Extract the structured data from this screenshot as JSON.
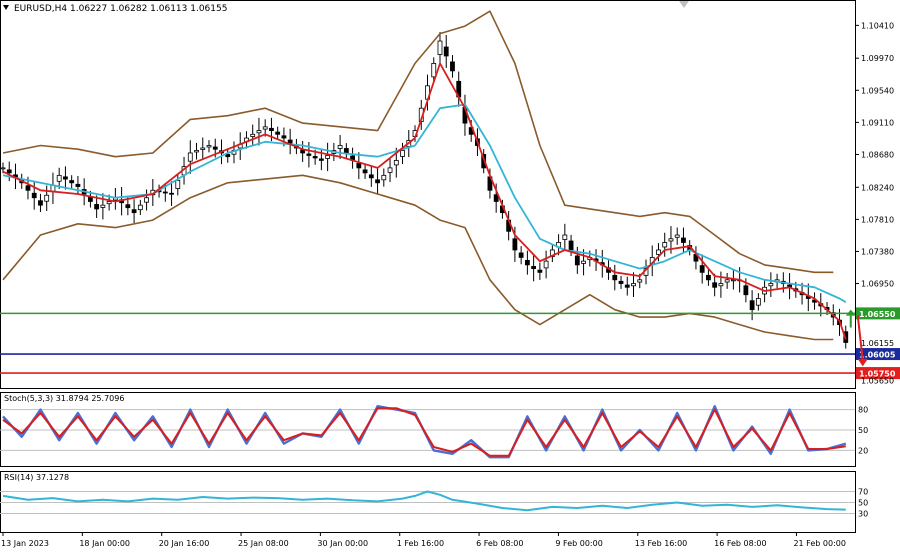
{
  "chart_data": [
    {
      "type": "candlestick",
      "title": "EURUSD,H4",
      "ohlc_text": "1.06227 1.06282 1.06113 1.06155",
      "ylim": [
        1.0555,
        1.1075
      ],
      "y_ticks": [
        "1.10410",
        "1.09970",
        "1.09540",
        "1.09110",
        "1.08680",
        "1.08240",
        "1.07810",
        "1.07380",
        "1.06950"
      ],
      "x_ticks": [
        "13 Jan 2023",
        "18 Jan 00:00",
        "20 Jan 16:00",
        "25 Jan 08:00",
        "30 Jan 00:00",
        "1 Feb 16:00",
        "6 Feb 08:00",
        "9 Feb 00:00",
        "13 Feb 16:00",
        "16 Feb 08:00",
        "21 Feb 00:00"
      ],
      "levels": [
        {
          "label": "1.06550",
          "value": 1.0655,
          "color": "#2a9a2a"
        },
        {
          "label": "1.06005",
          "value": 1.06005,
          "color": "#1a2a9a"
        },
        {
          "label": "1.05750",
          "value": 1.0575,
          "color": "#e21e1e"
        }
      ],
      "current_price_label": "1.06155",
      "bottom_price_label": "1.05650",
      "close_path": [
        [
          0,
          1.085
        ],
        [
          3,
          1.083
        ],
        [
          6,
          1.08
        ],
        [
          9,
          1.084
        ],
        [
          12,
          1.0825
        ],
        [
          15,
          1.0795
        ],
        [
          18,
          1.081
        ],
        [
          21,
          1.079
        ],
        [
          24,
          1.082
        ],
        [
          27,
          1.0815
        ],
        [
          30,
          1.087
        ],
        [
          33,
          1.088
        ],
        [
          36,
          1.0865
        ],
        [
          39,
          1.089
        ],
        [
          42,
          1.0905
        ],
        [
          45,
          1.089
        ],
        [
          48,
          1.087
        ],
        [
          51,
          1.086
        ],
        [
          54,
          1.088
        ],
        [
          57,
          1.085
        ],
        [
          60,
          1.083
        ],
        [
          63,
          1.086
        ],
        [
          66,
          1.09
        ],
        [
          68,
          1.096
        ],
        [
          70,
          1.102
        ],
        [
          72,
          1.098
        ],
        [
          74,
          1.091
        ],
        [
          76,
          1.088
        ],
        [
          78,
          1.082
        ],
        [
          80,
          1.079
        ],
        [
          82,
          1.074
        ],
        [
          84,
          1.072
        ],
        [
          86,
          1.071
        ],
        [
          88,
          1.074
        ],
        [
          90,
          1.076
        ],
        [
          92,
          1.072
        ],
        [
          94,
          1.073
        ],
        [
          96,
          1.072
        ],
        [
          98,
          1.07
        ],
        [
          100,
          1.069
        ],
        [
          102,
          1.07
        ],
        [
          104,
          1.073
        ],
        [
          106,
          1.075
        ],
        [
          108,
          1.076
        ],
        [
          110,
          1.074
        ],
        [
          112,
          1.071
        ],
        [
          114,
          1.069
        ],
        [
          116,
          1.07
        ],
        [
          118,
          1.07
        ],
        [
          120,
          1.066
        ],
        [
          122,
          1.069
        ],
        [
          124,
          1.07
        ],
        [
          126,
          1.069
        ],
        [
          128,
          1.068
        ],
        [
          130,
          1.067
        ],
        [
          132,
          1.066
        ],
        [
          134,
          1.064
        ],
        [
          135,
          1.0616
        ]
      ],
      "sma_fast": [
        [
          0,
          1.0845
        ],
        [
          6,
          1.082
        ],
        [
          12,
          1.0815
        ],
        [
          18,
          1.0805
        ],
        [
          24,
          1.0815
        ],
        [
          30,
          1.0855
        ],
        [
          36,
          1.0875
        ],
        [
          42,
          1.0895
        ],
        [
          48,
          1.0875
        ],
        [
          54,
          1.0865
        ],
        [
          60,
          1.085
        ],
        [
          66,
          1.089
        ],
        [
          70,
          1.099
        ],
        [
          74,
          1.093
        ],
        [
          78,
          1.084
        ],
        [
          82,
          1.076
        ],
        [
          86,
          1.0725
        ],
        [
          90,
          1.074
        ],
        [
          94,
          1.073
        ],
        [
          98,
          1.071
        ],
        [
          102,
          1.0705
        ],
        [
          106,
          1.074
        ],
        [
          110,
          1.0745
        ],
        [
          114,
          1.0705
        ],
        [
          118,
          1.07
        ],
        [
          122,
          1.0685
        ],
        [
          126,
          1.069
        ],
        [
          130,
          1.0675
        ],
        [
          134,
          1.0645
        ],
        [
          135,
          1.062
        ]
      ],
      "sma_slow": [
        [
          0,
          1.084
        ],
        [
          6,
          1.083
        ],
        [
          12,
          1.082
        ],
        [
          18,
          1.081
        ],
        [
          24,
          1.0815
        ],
        [
          30,
          1.0845
        ],
        [
          36,
          1.087
        ],
        [
          42,
          1.0885
        ],
        [
          48,
          1.088
        ],
        [
          54,
          1.087
        ],
        [
          60,
          1.0865
        ],
        [
          66,
          1.088
        ],
        [
          70,
          1.093
        ],
        [
          74,
          1.0935
        ],
        [
          78,
          1.088
        ],
        [
          82,
          1.081
        ],
        [
          86,
          1.0755
        ],
        [
          90,
          1.074
        ],
        [
          94,
          1.0735
        ],
        [
          98,
          1.0725
        ],
        [
          102,
          1.0715
        ],
        [
          106,
          1.0725
        ],
        [
          110,
          1.074
        ],
        [
          114,
          1.0725
        ],
        [
          118,
          1.071
        ],
        [
          122,
          1.07
        ],
        [
          126,
          1.0695
        ],
        [
          130,
          1.069
        ],
        [
          134,
          1.0675
        ],
        [
          135,
          1.067
        ]
      ],
      "bb_upper": [
        [
          0,
          1.087
        ],
        [
          6,
          1.088
        ],
        [
          12,
          1.0875
        ],
        [
          18,
          1.0865
        ],
        [
          24,
          1.087
        ],
        [
          30,
          1.0915
        ],
        [
          36,
          1.092
        ],
        [
          42,
          1.093
        ],
        [
          48,
          1.091
        ],
        [
          54,
          1.0905
        ],
        [
          60,
          1.09
        ],
        [
          66,
          1.099
        ],
        [
          70,
          1.103
        ],
        [
          74,
          1.104
        ],
        [
          78,
          1.106
        ],
        [
          82,
          1.099
        ],
        [
          86,
          1.088
        ],
        [
          90,
          1.08
        ],
        [
          94,
          1.0795
        ],
        [
          98,
          1.079
        ],
        [
          102,
          1.0785
        ],
        [
          106,
          1.079
        ],
        [
          110,
          1.0785
        ],
        [
          114,
          1.076
        ],
        [
          118,
          1.0735
        ],
        [
          122,
          1.072
        ],
        [
          126,
          1.0715
        ],
        [
          130,
          1.071
        ],
        [
          133,
          1.071
        ]
      ],
      "bb_lower": [
        [
          0,
          1.07
        ],
        [
          6,
          1.076
        ],
        [
          12,
          1.0775
        ],
        [
          18,
          1.077
        ],
        [
          24,
          1.078
        ],
        [
          30,
          1.081
        ],
        [
          36,
          1.083
        ],
        [
          42,
          1.0835
        ],
        [
          48,
          1.084
        ],
        [
          54,
          1.083
        ],
        [
          60,
          1.0815
        ],
        [
          66,
          1.08
        ],
        [
          70,
          1.078
        ],
        [
          74,
          1.077
        ],
        [
          78,
          1.07
        ],
        [
          82,
          1.066
        ],
        [
          86,
          1.064
        ],
        [
          90,
          1.066
        ],
        [
          94,
          1.068
        ],
        [
          98,
          1.066
        ],
        [
          102,
          1.065
        ],
        [
          106,
          1.065
        ],
        [
          110,
          1.0655
        ],
        [
          114,
          1.065
        ],
        [
          118,
          1.064
        ],
        [
          122,
          1.063
        ],
        [
          126,
          1.0625
        ],
        [
          130,
          1.062
        ],
        [
          133,
          1.062
        ]
      ]
    },
    {
      "type": "line",
      "title": "Stoch(5,3,3) 31.8794 25.7096",
      "ylim": [
        0,
        100
      ],
      "y_ticks": [
        "80",
        "50",
        "20"
      ],
      "series": [
        {
          "values": [
            [
              0,
              70
            ],
            [
              3,
              40
            ],
            [
              6,
              80
            ],
            [
              9,
              35
            ],
            [
              12,
              75
            ],
            [
              15,
              30
            ],
            [
              18,
              75
            ],
            [
              21,
              35
            ],
            [
              24,
              70
            ],
            [
              27,
              25
            ],
            [
              30,
              80
            ],
            [
              33,
              25
            ],
            [
              36,
              80
            ],
            [
              39,
              30
            ],
            [
              42,
              75
            ],
            [
              45,
              30
            ],
            [
              48,
              45
            ],
            [
              51,
              40
            ],
            [
              54,
              80
            ],
            [
              57,
              30
            ],
            [
              60,
              85
            ],
            [
              63,
              80
            ],
            [
              66,
              75
            ],
            [
              69,
              20
            ],
            [
              72,
              15
            ],
            [
              75,
              35
            ],
            [
              78,
              10
            ],
            [
              81,
              10
            ],
            [
              84,
              70
            ],
            [
              87,
              20
            ],
            [
              90,
              70
            ],
            [
              93,
              20
            ],
            [
              96,
              80
            ],
            [
              99,
              20
            ],
            [
              102,
              50
            ],
            [
              105,
              20
            ],
            [
              108,
              75
            ],
            [
              111,
              20
            ],
            [
              114,
              85
            ],
            [
              117,
              20
            ],
            [
              120,
              55
            ],
            [
              123,
              15
            ],
            [
              126,
              80
            ],
            [
              129,
              20
            ],
            [
              132,
              22
            ],
            [
              135,
              30
            ]
          ]
        },
        {
          "values": [
            [
              0,
              65
            ],
            [
              3,
              45
            ],
            [
              6,
              75
            ],
            [
              9,
              40
            ],
            [
              12,
              70
            ],
            [
              15,
              35
            ],
            [
              18,
              70
            ],
            [
              21,
              40
            ],
            [
              24,
              65
            ],
            [
              27,
              30
            ],
            [
              30,
              75
            ],
            [
              33,
              30
            ],
            [
              36,
              75
            ],
            [
              39,
              35
            ],
            [
              42,
              70
            ],
            [
              45,
              35
            ],
            [
              48,
              45
            ],
            [
              51,
              42
            ],
            [
              54,
              75
            ],
            [
              57,
              35
            ],
            [
              60,
              82
            ],
            [
              63,
              82
            ],
            [
              66,
              72
            ],
            [
              69,
              25
            ],
            [
              72,
              18
            ],
            [
              75,
              30
            ],
            [
              78,
              12
            ],
            [
              81,
              12
            ],
            [
              84,
              65
            ],
            [
              87,
              25
            ],
            [
              90,
              65
            ],
            [
              93,
              25
            ],
            [
              96,
              75
            ],
            [
              99,
              25
            ],
            [
              102,
              48
            ],
            [
              105,
              25
            ],
            [
              108,
              70
            ],
            [
              111,
              25
            ],
            [
              114,
              80
            ],
            [
              117,
              25
            ],
            [
              120,
              52
            ],
            [
              123,
              20
            ],
            [
              126,
              75
            ],
            [
              129,
              22
            ],
            [
              132,
              22
            ],
            [
              135,
              26
            ]
          ]
        }
      ]
    },
    {
      "type": "line",
      "title": "RSI(14) 37.1278",
      "ylim": [
        0,
        100
      ],
      "y_ticks": [
        "70",
        "50",
        "30"
      ],
      "series": [
        {
          "values": [
            [
              0,
              62
            ],
            [
              4,
              55
            ],
            [
              8,
              58
            ],
            [
              12,
              52
            ],
            [
              16,
              55
            ],
            [
              20,
              52
            ],
            [
              24,
              57
            ],
            [
              28,
              55
            ],
            [
              32,
              60
            ],
            [
              36,
              57
            ],
            [
              40,
              59
            ],
            [
              44,
              58
            ],
            [
              48,
              55
            ],
            [
              52,
              57
            ],
            [
              56,
              54
            ],
            [
              60,
              52
            ],
            [
              64,
              57
            ],
            [
              66,
              62
            ],
            [
              68,
              70
            ],
            [
              70,
              64
            ],
            [
              72,
              55
            ],
            [
              76,
              48
            ],
            [
              80,
              40
            ],
            [
              84,
              36
            ],
            [
              88,
              42
            ],
            [
              92,
              40
            ],
            [
              96,
              44
            ],
            [
              100,
              40
            ],
            [
              104,
              46
            ],
            [
              108,
              50
            ],
            [
              112,
              44
            ],
            [
              116,
              46
            ],
            [
              120,
              42
            ],
            [
              124,
              45
            ],
            [
              128,
              41
            ],
            [
              132,
              38
            ],
            [
              135,
              37
            ]
          ]
        }
      ]
    }
  ]
}
